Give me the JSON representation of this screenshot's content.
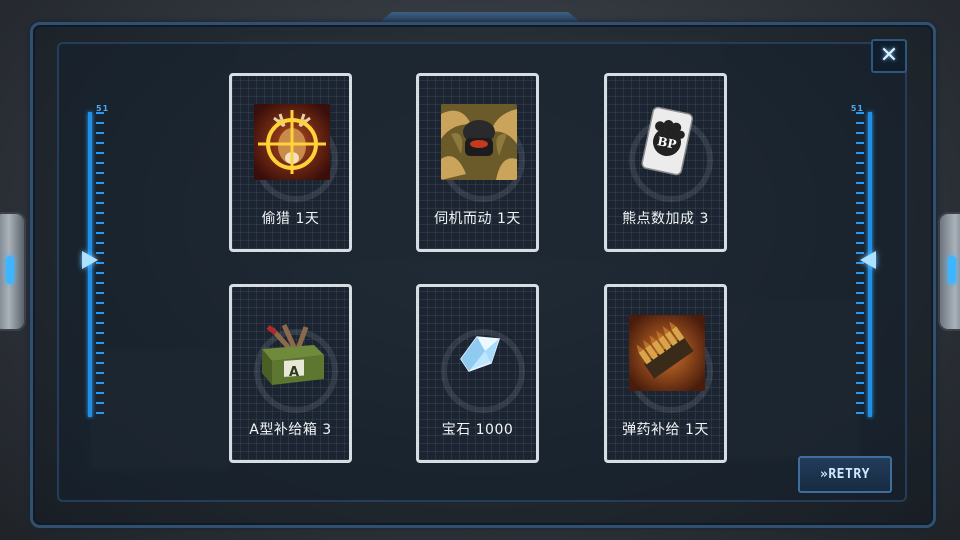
{
  "dialog": {
    "close_label": "✕",
    "scale_left_label": "51",
    "scale_right_label": "51",
    "retry_label": "»RETRY"
  },
  "rewards": [
    {
      "label": "偷猎 1天",
      "icon": "deer-crosshair-icon"
    },
    {
      "label": "伺机而动 1天",
      "icon": "camouflaged-soldier-icon"
    },
    {
      "label": "熊点数加成 3",
      "icon": "bp-card-icon",
      "badge_text": "BP"
    },
    {
      "label": "A型补给箱 3",
      "icon": "supply-crate-icon",
      "badge_text": "A"
    },
    {
      "label": "宝石 1000",
      "icon": "gem-icon"
    },
    {
      "label": "弹药补给 1天",
      "icon": "ammo-clip-icon"
    }
  ],
  "colors": {
    "accent_blue": "#1f8fe8",
    "card_border": "#d6dde3"
  }
}
